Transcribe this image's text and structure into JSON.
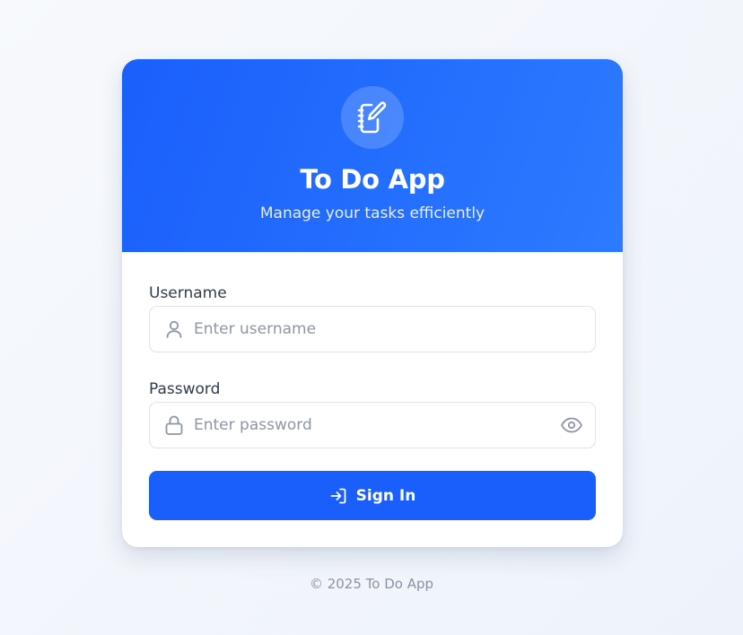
{
  "header": {
    "logo_icon": "notebook-pen-icon",
    "title": "To Do App",
    "subtitle": "Manage your tasks efficiently"
  },
  "form": {
    "username": {
      "label": "Username",
      "placeholder": "Enter username",
      "value": "",
      "icon": "user-icon"
    },
    "password": {
      "label": "Password",
      "placeholder": "Enter password",
      "value": "",
      "icon": "lock-icon",
      "toggle_icon": "eye-icon"
    },
    "submit": {
      "label": "Sign In",
      "icon": "sign-in-icon"
    }
  },
  "footer": {
    "text": "© 2025 To Do App"
  },
  "colors": {
    "primary": "#1a5ffb",
    "header_gradient_end": "#2c7bff",
    "page_background": "#f3f6fb",
    "placeholder": "#8d96a5",
    "label": "#2f3a4b"
  }
}
